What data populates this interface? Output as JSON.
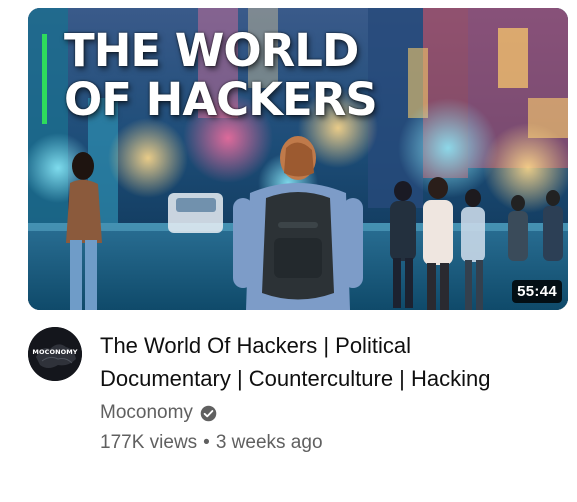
{
  "video": {
    "thumbnail_title_line1": "THE WORLD",
    "thumbnail_title_line2": "OF HACKERS",
    "duration": "55:44",
    "title_line1": "The World Of Hackers | Political",
    "title_line2": "Documentary | Counterculture | Hacking",
    "channel_name": "Moconomy",
    "channel_avatar_text": "MOCONOMY",
    "views": "177K views",
    "separator": "•",
    "age": "3 weeks ago"
  },
  "icons": {
    "verified": "verified-check-icon"
  },
  "colors": {
    "title_text": "#0f0f0f",
    "meta_text": "#606060",
    "accent_bar": "#2edb5c",
    "duration_bg": "#000000"
  }
}
